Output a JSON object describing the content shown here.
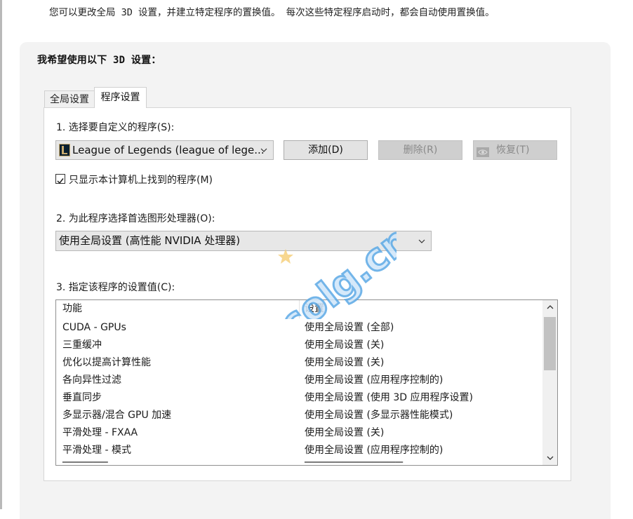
{
  "intro_text": "您可以更改全局 3D 设置，并建立特定程序的置换值。 每次这些特定程序启动时，都会自动使用置换值。",
  "panel_title": "我希望使用以下 3D 设置：",
  "tabs": [
    {
      "label": "全局设置",
      "active": false
    },
    {
      "label": "程序设置",
      "active": true
    }
  ],
  "section1": {
    "label": "1. 选择要自定义的程序(S):",
    "program_select": "League of Legends (league of lege...",
    "add_button": "添加(D)",
    "remove_button": "删除(R)",
    "restore_button": "恢复(T)",
    "checkbox_label": "只显示本计算机上找到的程序(M)",
    "checkbox_checked": true
  },
  "section2": {
    "label": "2. 为此程序选择首选图形处理器(O):",
    "gpu_select": "使用全局设置 (高性能 NVIDIA 处理器)"
  },
  "section3": {
    "label": "3. 指定该程序的设置值(C):",
    "columns": [
      "功能",
      "设置"
    ],
    "rows": [
      {
        "feature": "CUDA - GPUs",
        "setting": "使用全局设置 (全部)"
      },
      {
        "feature": "三重缓冲",
        "setting": "使用全局设置 (关)"
      },
      {
        "feature": "优化以提高计算性能",
        "setting": "使用全局设置 (关)"
      },
      {
        "feature": "各向异性过滤",
        "setting": "使用全局设置 (应用程序控制的)"
      },
      {
        "feature": "垂直同步",
        "setting": "使用全局设置 (使用 3D 应用程序设置)"
      },
      {
        "feature": "多显示器/混合 GPU 加速",
        "setting": "使用全局设置 (多显示器性能模式)"
      },
      {
        "feature": "平滑处理 - FXAA",
        "setting": "使用全局设置 (关)"
      },
      {
        "feature": "平滑处理 - 模式",
        "setting": "使用全局设置 (应用程序控制的)"
      }
    ]
  },
  "watermark": "colg.cn",
  "colors": {
    "panel_bg": "#f3f3f3",
    "button_bg": "#e3e3e3",
    "disabled_bg": "#cfcfcf",
    "watermark": "#5ba9e6",
    "nvidia_green": "#76b900"
  }
}
